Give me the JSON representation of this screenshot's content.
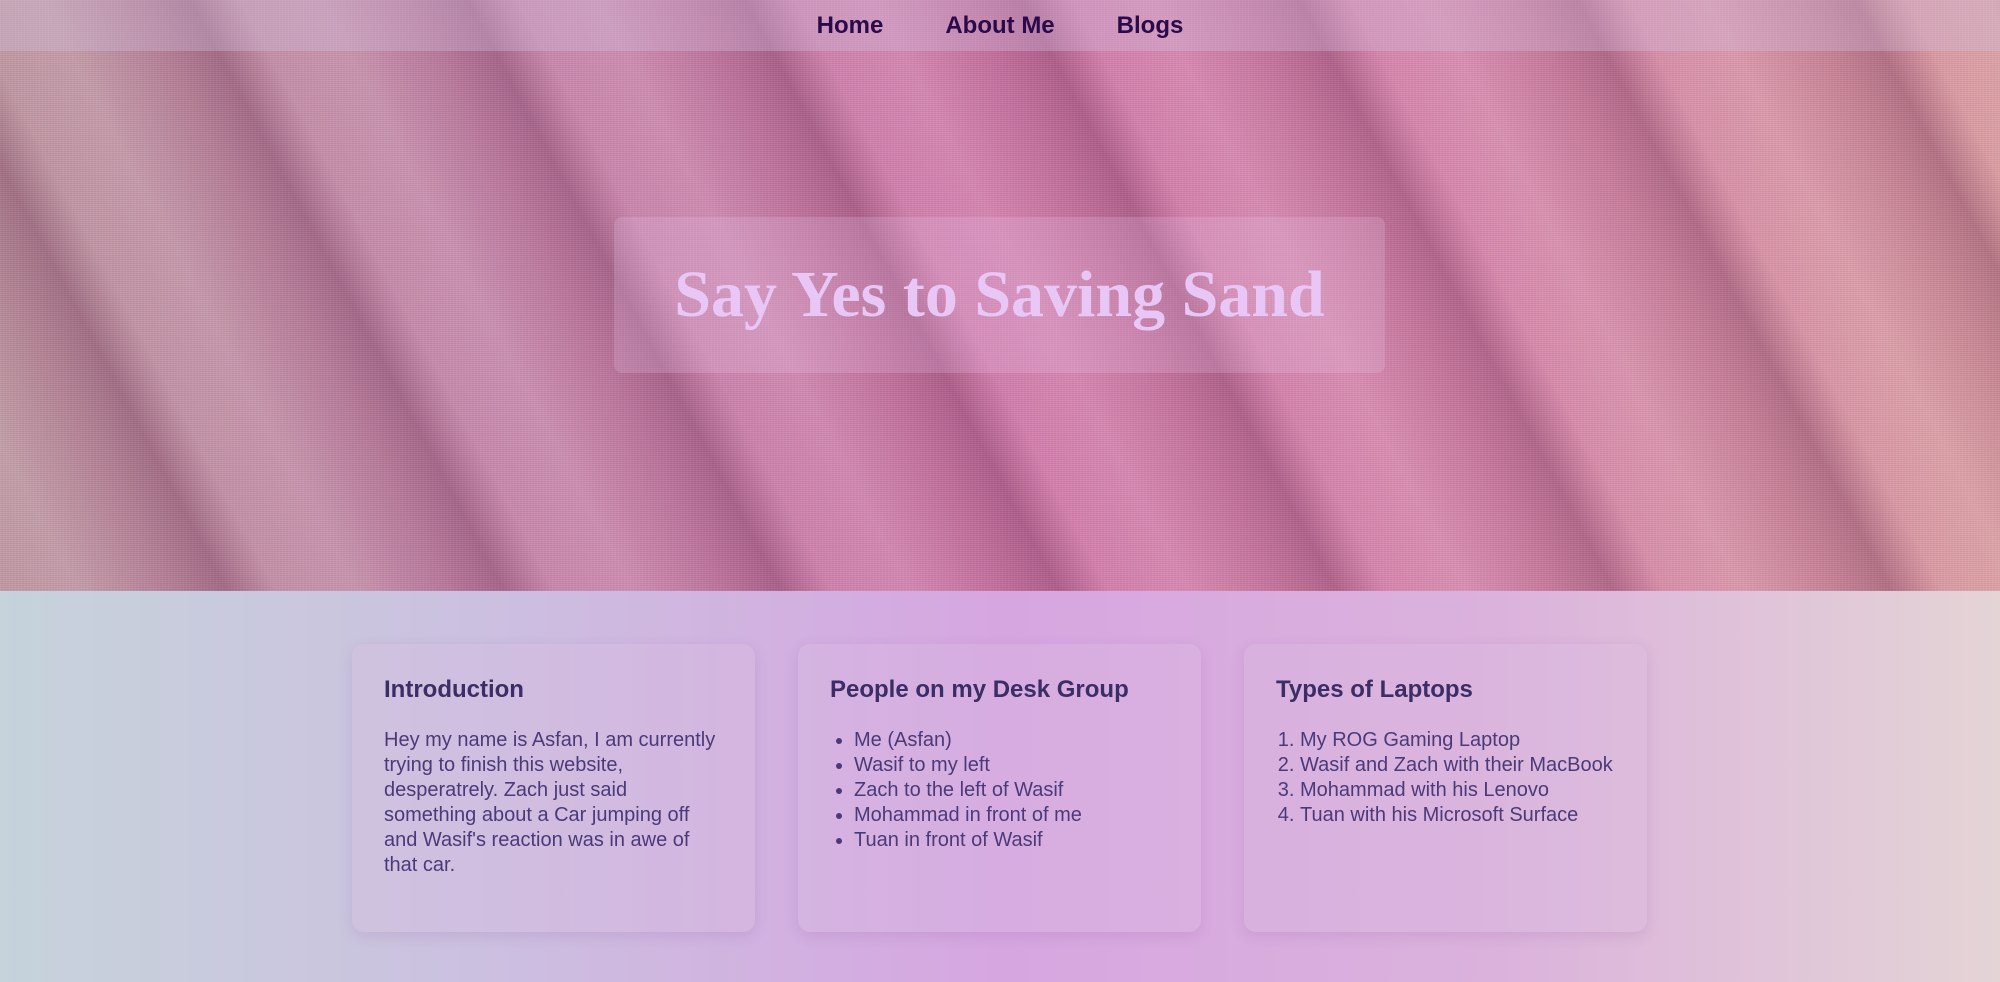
{
  "nav": {
    "items": [
      {
        "label": "Home"
      },
      {
        "label": "About Me"
      },
      {
        "label": "Blogs"
      }
    ]
  },
  "hero": {
    "title": "Say Yes to Saving Sand"
  },
  "cards": {
    "intro": {
      "title": "Introduction",
      "text": "Hey my name is Asfan, I am currently trying to finish this website, desperatrely. Zach just said something about a Car jumping off and Wasif's reaction was in awe of that car."
    },
    "desk_group": {
      "title": "People on my Desk Group",
      "items": [
        "Me (Asfan)",
        "Wasif to my left",
        "Zach to the left of Wasif",
        "Mohammad in front of me",
        "Tuan in front of Wasif"
      ]
    },
    "laptops": {
      "title": "Types of Laptops",
      "items": [
        "My ROG Gaming Laptop",
        "Wasif and Zach with their MacBook",
        "Mohammad with his Lenovo",
        "Tuan with his Microsoft Surface"
      ]
    }
  },
  "colors": {
    "nav_text": "#2a0a4a",
    "hero_title": "#e8c6f6",
    "card_title": "#3b2d66",
    "card_text": "#4a3a7a"
  }
}
